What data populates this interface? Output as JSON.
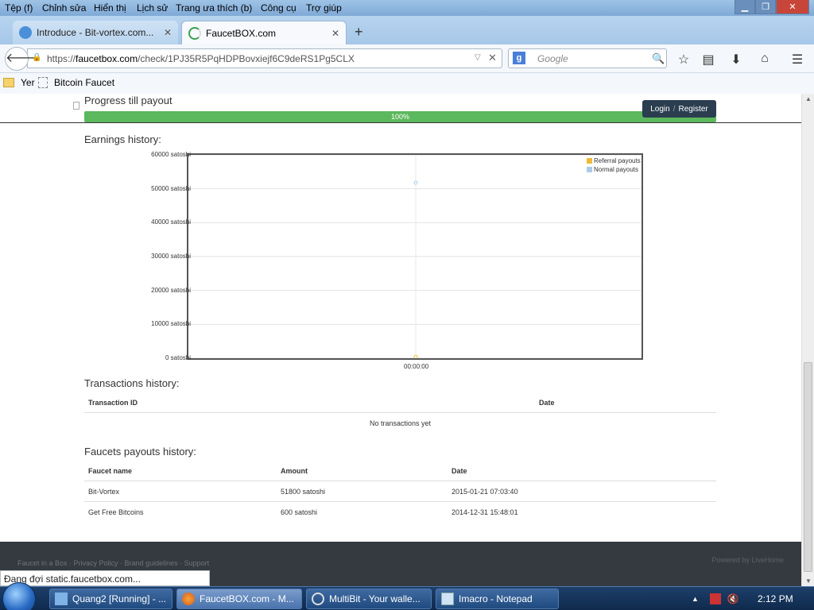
{
  "menubar": {
    "items": [
      "Tệp (f)",
      "Chỉnh sửa",
      "Hiển thị",
      "Lịch sử",
      "Trang ưa thích (b)",
      "Công cụ",
      "Trợ giúp"
    ]
  },
  "tabs": [
    {
      "label": "Introduce - Bit-vortex.com..."
    },
    {
      "label": "FaucetBOX.com"
    }
  ],
  "nav": {
    "url_prefix": "https://",
    "url_domain": "faucetbox.com",
    "url_path": "/check/1PJ35R5PqHDPBovxiejf6C9deRS1Pg5CLX",
    "search_placeholder": "Google",
    "search_engine_letter": "g"
  },
  "bookmarks": [
    {
      "label": "Yer"
    },
    {
      "label": "Bitcoin Faucet"
    }
  ],
  "page": {
    "progress_title": "Progress till payout",
    "progress_label": "100%",
    "progress_fraction": 1.0,
    "login_label": "Login",
    "login_sep": "/",
    "register_label": "Register",
    "earnings_title": "Earnings history:",
    "transactions_title": "Transactions history:",
    "transactions_headers": [
      "Transaction ID",
      "Date"
    ],
    "transactions_empty": "No transactions yet",
    "payouts_title": "Faucets payouts history:",
    "payouts_headers": [
      "Faucet name",
      "Amount",
      "Date"
    ],
    "payouts_rows": [
      {
        "name": "Bit-Vortex",
        "amount": "51800 satoshi",
        "date": "2015-01-21 07:03:40"
      },
      {
        "name": "Get Free Bitcoins",
        "amount": "600 satoshi",
        "date": "2014-12-31 15:48:01"
      }
    ],
    "footer_links": "Faucet in a Box · Privacy Policy · Brand guidelines · Support",
    "powered_by": "Powered by LiveHome"
  },
  "chart_data": {
    "type": "scatter",
    "title": "",
    "xlabel": "",
    "ylabel": "",
    "ylim": [
      0,
      60000
    ],
    "yticks": [
      "0 satoshi",
      "10000 satoshi",
      "20000 satoshi",
      "30000 satoshi",
      "40000 satoshi",
      "50000 satoshi",
      "60000 satoshi"
    ],
    "ytick_values": [
      0,
      10000,
      20000,
      30000,
      40000,
      50000,
      60000
    ],
    "x": [
      "00:00:00"
    ],
    "grid": true,
    "legend_position": "top-right",
    "series": [
      {
        "name": "Referral payouts",
        "color": "#f0b93a",
        "values": [
          0
        ]
      },
      {
        "name": "Normal payouts",
        "color": "#a9cbe8",
        "values": [
          51800
        ]
      }
    ]
  },
  "status_text": "Đang đợi static.faucetbox.com...",
  "taskbar": {
    "items": [
      {
        "label": "Quang2 [Running] - ...",
        "icon": "virtualbox-icon"
      },
      {
        "label": "FaucetBOX.com - M...",
        "icon": "firefox-icon"
      },
      {
        "label": "MultiBit - Your walle...",
        "icon": "multibit-icon"
      },
      {
        "label": "Imacro - Notepad",
        "icon": "notepad-icon"
      }
    ],
    "clock": "2:12 PM"
  }
}
